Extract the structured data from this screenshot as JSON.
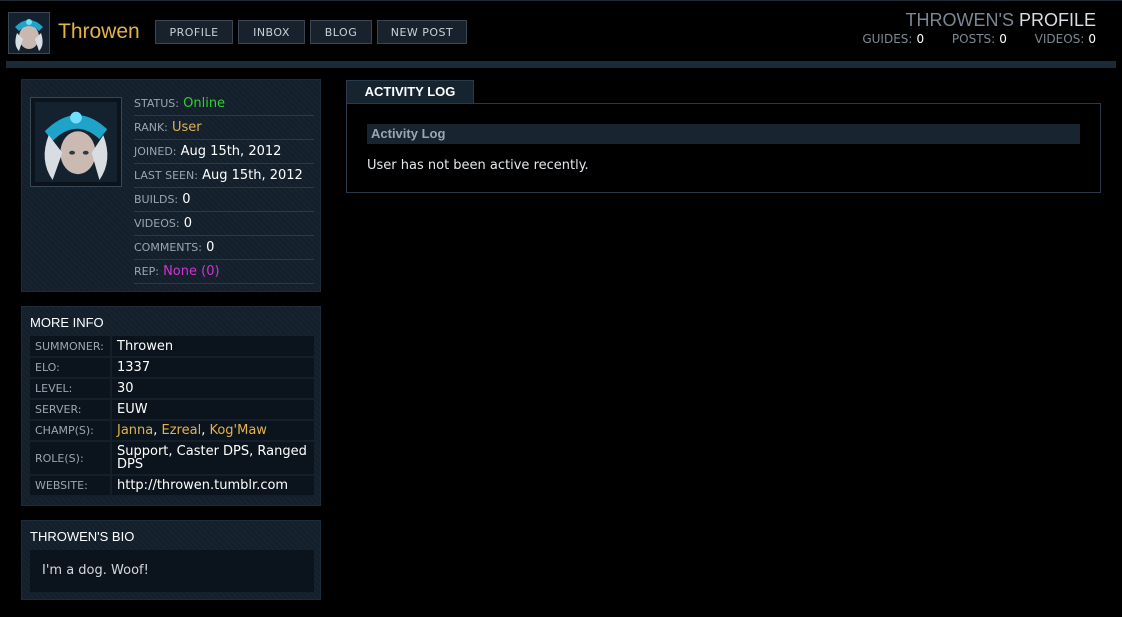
{
  "user": {
    "name": "Throwen"
  },
  "nav": {
    "items": [
      "PROFILE",
      "INBOX",
      "BLOG",
      "NEW POST"
    ]
  },
  "header": {
    "title_part1": "THROWEN'S",
    "title_part2": "PROFILE",
    "stats": [
      {
        "label": "GUIDES:",
        "value": "0"
      },
      {
        "label": "POSTS:",
        "value": "0"
      },
      {
        "label": "VIDEOS:",
        "value": "0"
      }
    ]
  },
  "profile": {
    "status": {
      "label": "STATUS:",
      "value": "Online"
    },
    "rank": {
      "label": "RANK:",
      "value": "User"
    },
    "joined": {
      "label": "JOINED:",
      "value": "Aug 15th, 2012"
    },
    "last_seen": {
      "label": "LAST SEEN:",
      "value": "Aug 15th, 2012"
    },
    "builds": {
      "label": "BUILDS:",
      "value": "0"
    },
    "videos": {
      "label": "VIDEOS:",
      "value": "0"
    },
    "comments": {
      "label": "COMMENTS:",
      "value": "0"
    },
    "rep": {
      "label": "REP:",
      "value": "None (0)"
    }
  },
  "more_info": {
    "title": "MORE INFO",
    "rows": [
      {
        "label": "SUMMONER:",
        "value": "Throwen"
      },
      {
        "label": "ELO:",
        "value": "1337"
      },
      {
        "label": "LEVEL:",
        "value": "30"
      },
      {
        "label": "SERVER:",
        "value": "EUW"
      },
      {
        "label": "CHAMP(S):",
        "champs": [
          "Janna",
          "Ezreal",
          "Kog'Maw"
        ]
      },
      {
        "label": "ROLE(S):",
        "value": "Support, Caster DPS, Ranged DPS"
      },
      {
        "label": "WEBSITE:",
        "value": "http://throwen.tumblr.com"
      }
    ]
  },
  "bio": {
    "title": "THROWEN'S BIO",
    "text": "I'm a dog. Woof!"
  },
  "activity": {
    "tab": "ACTIVITY LOG",
    "heading": "Activity Log",
    "text": "User has not been active recently."
  },
  "colors": {
    "gold": "#e3b24c",
    "online": "#2ed12e",
    "rep": "#d133d1",
    "panel": "#13202b"
  }
}
